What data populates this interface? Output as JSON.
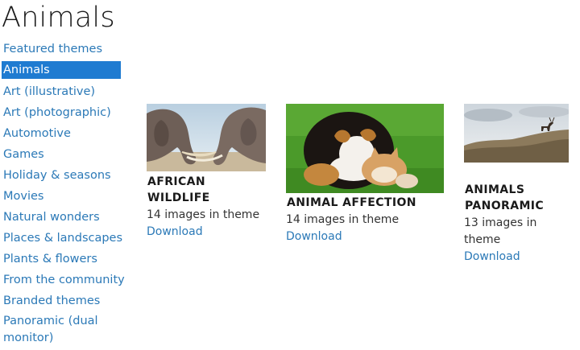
{
  "page": {
    "title": "Animals"
  },
  "colors": {
    "link": "#2b79b7",
    "selected": "#1f7bd1"
  },
  "sidebar": {
    "items": [
      {
        "label": "Featured themes"
      },
      {
        "label": "Animals"
      },
      {
        "label": "Art (illustrative)"
      },
      {
        "label": "Art (photographic)"
      },
      {
        "label": "Automotive"
      },
      {
        "label": "Games"
      },
      {
        "label": "Holiday & seasons"
      },
      {
        "label": "Movies"
      },
      {
        "label": "Natural wonders"
      },
      {
        "label": "Places & landscapes"
      },
      {
        "label": "Plants & flowers"
      },
      {
        "label": "From the community"
      },
      {
        "label": "Branded themes"
      },
      {
        "label": "Panoramic (dual monitor)"
      }
    ],
    "selected": "Animals"
  },
  "themes": [
    {
      "title": "AFRICAN WILDLIFE",
      "count": "14 images in theme",
      "link": "Download",
      "image": "elephants-photo"
    },
    {
      "title": "ANIMAL AFFECTION",
      "count": "14 images in theme",
      "link": "Download",
      "image": "puppy-and-kitten-photo"
    },
    {
      "title": "ANIMALS PANORAMIC",
      "count": "13 images in theme",
      "link": "Download",
      "image": "deer-on-cliff-panorama-photo"
    }
  ]
}
